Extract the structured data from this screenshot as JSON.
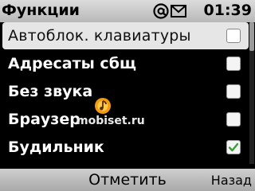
{
  "status_bar": {
    "title": "Функции",
    "clock": "01:39"
  },
  "list": {
    "items": [
      {
        "label": "Автоблок. клавиатуры",
        "checked": false,
        "selected": true
      },
      {
        "label": "Адресаты сбщ",
        "checked": false,
        "selected": false
      },
      {
        "label": "Без звука",
        "checked": false,
        "selected": false
      },
      {
        "label": "Браузер",
        "checked": false,
        "selected": false
      },
      {
        "label": "Будильник",
        "checked": true,
        "selected": false
      }
    ]
  },
  "watermark": {
    "text": "mobiset.ru"
  },
  "softkeys": {
    "middle": "Отметить",
    "right": "Назад"
  },
  "icons": {
    "indicators": [
      "at-sign-icon",
      "envelope-icon"
    ],
    "logo": "mobiset-logo-icon",
    "check": "checkmark-icon"
  },
  "colors": {
    "check_green": "#3c9c3c",
    "selection_bg": "#e6e6e6",
    "logo_orange": "#f29a10"
  }
}
